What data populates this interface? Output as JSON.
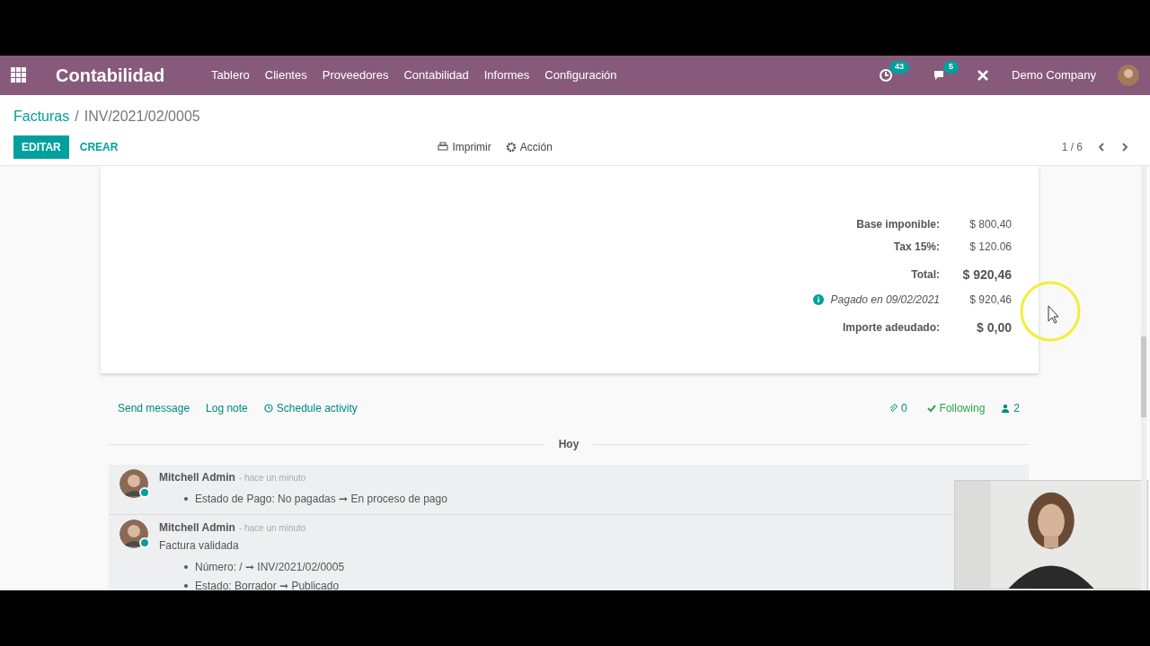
{
  "navbar": {
    "app_title": "Contabilidad",
    "menu": [
      "Tablero",
      "Clientes",
      "Proveedores",
      "Contabilidad",
      "Informes",
      "Configuración"
    ],
    "activity_count": "43",
    "message_count": "5",
    "company": "Demo Company"
  },
  "breadcrumb": {
    "parent": "Facturas",
    "separator": "/",
    "current": "INV/2021/02/0005"
  },
  "actions": {
    "edit": "EDITAR",
    "create": "CREAR",
    "print": "Imprimir",
    "action": "Acción",
    "pager": "1 / 6"
  },
  "totals": [
    {
      "kind": "line",
      "label": "Base imponible:",
      "value": "$ 800,40"
    },
    {
      "kind": "line",
      "label": "Tax 15%:",
      "value": "$ 120.06"
    },
    {
      "kind": "total",
      "label": "Total:",
      "value": "$ 920,46"
    },
    {
      "kind": "payment",
      "label": "Pagado en 09/02/2021",
      "value": "$ 920,46"
    },
    {
      "kind": "total",
      "label": "Importe adeudado:",
      "value": "$ 0,00"
    }
  ],
  "chatter": {
    "send_message": "Send message",
    "log_note": "Log note",
    "schedule": "Schedule activity",
    "attachments": "0",
    "following": "Following",
    "followers": "2",
    "date_separator": "Hoy",
    "messages": [
      {
        "author": "Mitchell Admin",
        "time": "- hace un minuto",
        "changes": [
          "Estado de Pago: No pagadas ➞ En proceso de pago"
        ]
      },
      {
        "author": "Mitchell Admin",
        "time": "- hace un minuto",
        "body": "Factura validada",
        "changes": [
          "Número: / ➞ INV/2021/02/0005",
          "Estado: Borrador ➞ Publicado"
        ]
      }
    ]
  }
}
